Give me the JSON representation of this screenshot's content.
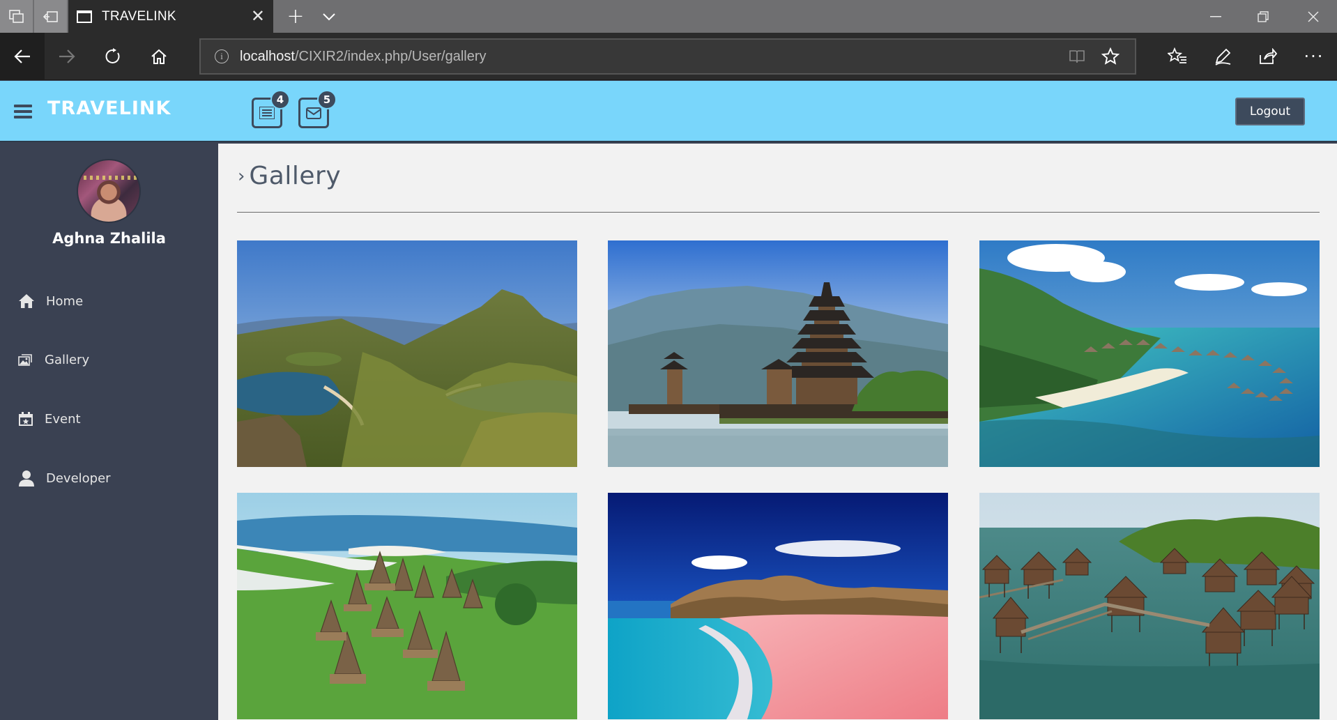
{
  "browser": {
    "tab_title": "TRAVELINK",
    "url_host": "localhost",
    "url_path": "/CIXIR2/index.php/User/gallery"
  },
  "header": {
    "brand": "TRAVELINK",
    "tasks_count": "4",
    "messages_count": "5",
    "logout_label": "Logout"
  },
  "sidebar": {
    "user_name": "Aghna Zhalila",
    "items": [
      {
        "label": "Home",
        "icon": "home-icon"
      },
      {
        "label": "Gallery",
        "icon": "gallery-icon"
      },
      {
        "label": "Event",
        "icon": "calendar-icon"
      },
      {
        "label": "Developer",
        "icon": "user-icon"
      }
    ]
  },
  "main": {
    "page_title": "Gallery",
    "photos": [
      {
        "name": "padar-island-hills-photo"
      },
      {
        "name": "lake-temple-pagoda-photo"
      },
      {
        "name": "tropical-overwater-resort-photo"
      },
      {
        "name": "traditional-village-roofs-photo"
      },
      {
        "name": "pink-beach-photo"
      },
      {
        "name": "stilt-bungalows-sea-photo"
      }
    ]
  },
  "colors": {
    "header_bg": "#79d6fb",
    "sidebar_bg": "#3a4152",
    "content_bg": "#f2f2f2",
    "accent_dark": "#3d4a5c"
  }
}
